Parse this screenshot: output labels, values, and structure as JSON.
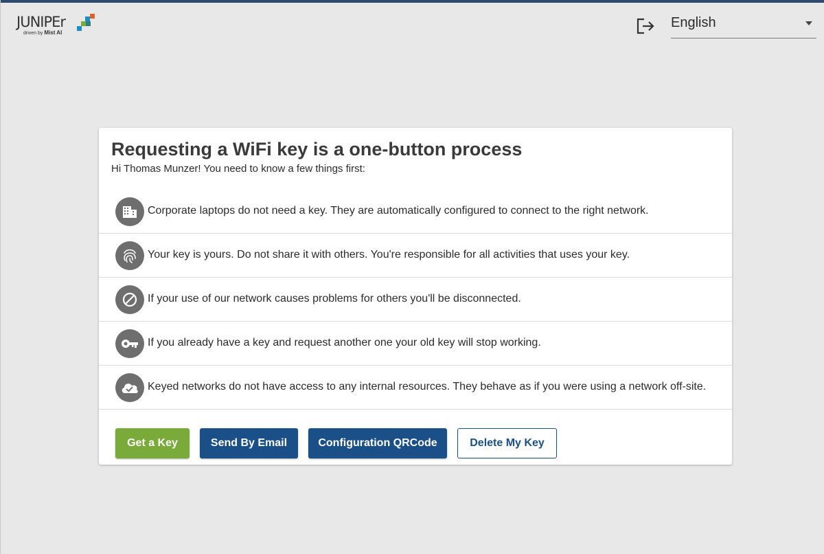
{
  "brand": {
    "logo_word": "JUNIPEr",
    "logo_sub_prefix": "driven by",
    "logo_sub_brand": "Mist AI",
    "colors": {
      "orange": "#e2632a",
      "green": "#7aab3a",
      "blue": "#1a8ec9",
      "teal": "#2f7f86"
    }
  },
  "header": {
    "logout_icon": "logout-icon",
    "language": {
      "selected": "English",
      "icon": "chevron-down-icon"
    }
  },
  "card": {
    "title": "Requesting a WiFi key is a one-button process",
    "subtitle": "Hi Thomas Munzer! You need to know a few things first:",
    "items": [
      {
        "icon": "building-icon",
        "text": "Corporate laptops do not need a key. They are automatically configured to connect to the right network."
      },
      {
        "icon": "fingerprint-icon",
        "text": "Your key is yours. Do not share it with others. You're responsible for all activities that uses your key."
      },
      {
        "icon": "block-icon",
        "text": "If your use of our network causes problems for others you'll be disconnected."
      },
      {
        "icon": "key-icon",
        "text": "If you already have a key and request another one your old key will stop working."
      },
      {
        "icon": "cloud-check-icon",
        "text": "Keyed networks do not have access to any internal resources. They behave as if you were using a network off-site."
      }
    ],
    "buttons": {
      "get_key": "Get a Key",
      "send_email": "Send By Email",
      "qr": "Configuration QRCode",
      "delete": "Delete My Key"
    }
  },
  "colors": {
    "page_bg": "#e8e8e8",
    "primary_blue": "#1a4f88",
    "accent_green": "#7aab3a",
    "icon_gray": "#6e6e6e"
  }
}
